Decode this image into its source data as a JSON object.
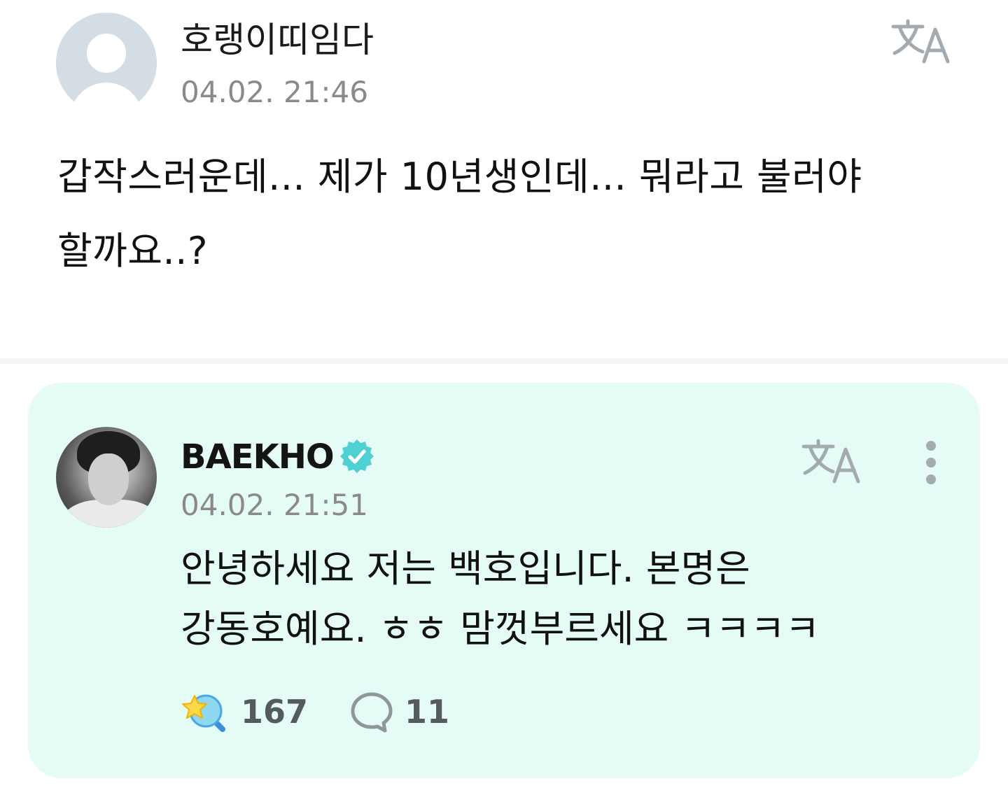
{
  "question": {
    "author": "호랭이띠임다",
    "timestamp": "04.02. 21:46",
    "text_line1": "갑작스러운데... 제가 10년생인데... 뭐라고 불러야",
    "text_line2": "할까요..?",
    "translate_icon": "translate-icon"
  },
  "answer": {
    "author": "BAEKHO",
    "verified_icon": "verified-badge-icon",
    "timestamp": "04.02. 21:51",
    "text_line1": "안녕하세요 저는 백호입니다. 본명은",
    "text_line2": "강동호예요. ㅎㅎ 맘껏부르세요 ㅋㅋㅋㅋ",
    "reaction_count": "167",
    "comment_count": "11",
    "card_color": "#e5fbf6",
    "accent_color": "#3ccfcf"
  }
}
